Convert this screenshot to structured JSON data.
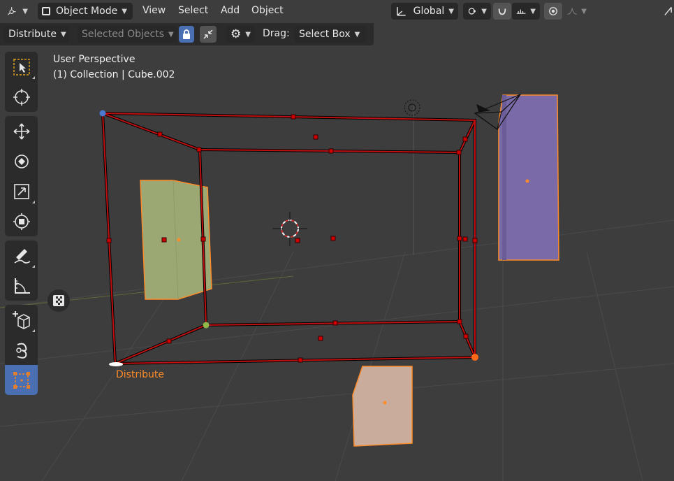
{
  "header": {
    "mode": "Object Mode",
    "menus": [
      "View",
      "Select",
      "Add",
      "Object"
    ],
    "orientation": "Global"
  },
  "tool_settings": {
    "operation": "Distribute",
    "target": "Selected Objects",
    "drag_label": "Drag:",
    "drag_value": "Select Box"
  },
  "viewport": {
    "view_name": "User Perspective",
    "collection_info": "(1) Collection | Cube.002",
    "cage_label": "Distribute"
  },
  "toolbar": {
    "tools": [
      "select-box",
      "cursor",
      "move",
      "rotate",
      "scale",
      "transform",
      "annotate",
      "measure",
      "add-cube",
      "spin",
      "align-distribute"
    ],
    "selected": "align-distribute"
  },
  "colors": {
    "background": "#3d3d3d",
    "accent": "#4a6fb3",
    "selection_outline": "#ff8c2a",
    "cage": "#b30000",
    "object_green": "#9ba874",
    "object_purple": "#7a6aa8",
    "object_pink": "#c9ac9c"
  }
}
